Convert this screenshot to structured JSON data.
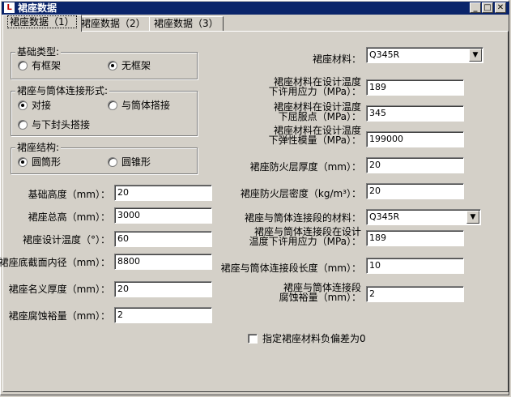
{
  "window": {
    "title": "裙座数据",
    "icon": "app-icon"
  },
  "tabs": [
    {
      "label": "裙座数据（1）"
    },
    {
      "label": "裙座数据（2）"
    },
    {
      "label": "裙座数据（3）"
    }
  ],
  "foundation_type": {
    "label": "基础类型:",
    "options": [
      {
        "label": "有框架"
      },
      {
        "label": "无框架"
      }
    ],
    "selected": "无框架"
  },
  "connection_form": {
    "label": "裙座与筒体连接形式:",
    "options": [
      {
        "label": "对接"
      },
      {
        "label": "与筒体搭接"
      },
      {
        "label": "与下封头搭接"
      }
    ],
    "selected": "对接"
  },
  "structure": {
    "label": "裙座结构:",
    "options": [
      {
        "label": "圆筒形"
      },
      {
        "label": "圆锥形"
      }
    ],
    "selected": "圆筒形"
  },
  "left_fields": [
    {
      "label": "基础高度（mm）：",
      "value": "20"
    },
    {
      "label": "裙座总高（mm）：",
      "value": "3000"
    },
    {
      "label": "裙座设计温度（°）：",
      "value": "60"
    },
    {
      "label": "裙座底截面内径（mm）：",
      "value": "8800"
    },
    {
      "label": "裙座名义厚度（mm）：",
      "value": "20"
    },
    {
      "label": "裙座腐蚀裕量（mm）：",
      "value": "2"
    }
  ],
  "right": {
    "material": {
      "label": "裙座材料：",
      "value": "Q345R"
    },
    "allow_stress": {
      "line1": "裙座材料在设计温度",
      "line2": "下许用应力（MPa）：",
      "value": "189"
    },
    "yield": {
      "line1": "裙座材料在设计温度",
      "line2": "下屈服点（MPa）：",
      "value": "345"
    },
    "modulus": {
      "line1": "裙座材料在设计温度",
      "line2": "下弹性模量（MPa）：",
      "value": "199000"
    },
    "fire_thickness": {
      "label": "裙座防火层厚度（mm）：",
      "value": "20"
    },
    "fire_density": {
      "label": "裙座防火层密度（kg/m³）：",
      "value": "20"
    },
    "conn_material": {
      "label": "裙座与筒体连接段的材料：",
      "value": "Q345R"
    },
    "conn_allow_stress": {
      "line1": "裙座与筒体连接段在设计",
      "line2": "温度下许用应力（MPa）：",
      "value": "189"
    },
    "conn_length": {
      "label": "裙座与筒体连接段长度（mm）：",
      "value": "10"
    },
    "conn_corrosion": {
      "line1": "裙座与筒体连接段",
      "line2": "腐蚀裕量（mm）：",
      "value": "2"
    }
  },
  "negative_tolerance": {
    "label": "指定裙座材料负偏差为0",
    "checked": false
  }
}
